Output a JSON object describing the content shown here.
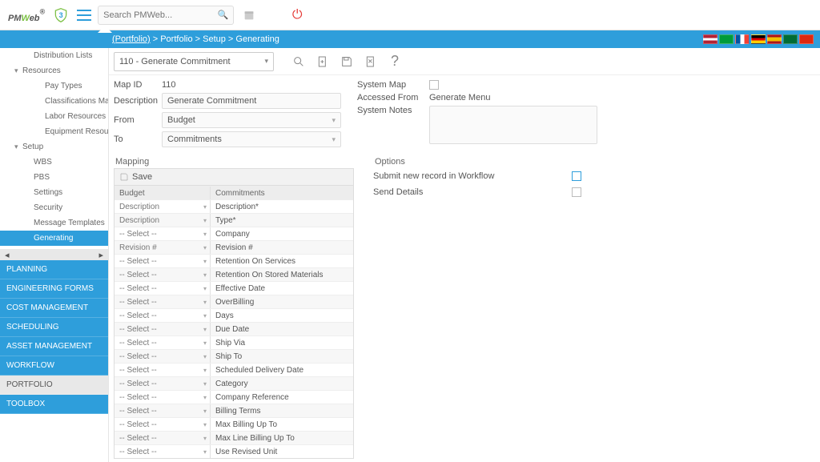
{
  "header": {
    "logo_text_prefix": "PM",
    "logo_text_accent": "W",
    "logo_text_suffix": "eb",
    "shield_badge": "3",
    "search_placeholder": "Search PMWeb..."
  },
  "breadcrumb": {
    "portfolio_link": "(Portfolio)",
    "trail": " > Portfolio > Setup > Generating"
  },
  "flags": [
    "us",
    "br",
    "fr",
    "de",
    "es",
    "sa",
    "cn"
  ],
  "sidebar": {
    "tree": [
      {
        "label": "Distribution Lists",
        "level": "l2"
      },
      {
        "label": "Resources",
        "level": "l1",
        "caret": true,
        "open": true
      },
      {
        "label": "Pay Types",
        "level": "l3"
      },
      {
        "label": "Classifications Ma",
        "level": "l3"
      },
      {
        "label": "Labor Resources",
        "level": "l3"
      },
      {
        "label": "Equipment Resour",
        "level": "l3"
      },
      {
        "label": "Setup",
        "level": "l1",
        "caret": true,
        "open": true
      },
      {
        "label": "WBS",
        "level": "l2"
      },
      {
        "label": "PBS",
        "level": "l2"
      },
      {
        "label": "Settings",
        "level": "l2"
      },
      {
        "label": "Security",
        "level": "l2"
      },
      {
        "label": "Message Templates",
        "level": "l2"
      },
      {
        "label": "Generating",
        "level": "l2",
        "sel": true
      }
    ],
    "modules": [
      "PLANNING",
      "ENGINEERING FORMS",
      "COST MANAGEMENT",
      "SCHEDULING",
      "ASSET MANAGEMENT",
      "WORKFLOW",
      "PORTFOLIO",
      "TOOLBOX"
    ],
    "active_module": "PORTFOLIO"
  },
  "toolbar": {
    "record_selector": "110 - Generate Commitment"
  },
  "form": {
    "map_id_label": "Map ID",
    "map_id": "110",
    "description_label": "Description",
    "description": "Generate Commitment",
    "from_label": "From",
    "from": "Budget",
    "to_label": "To",
    "to": "Commitments",
    "system_map_label": "System Map",
    "accessed_from_label": "Accessed From",
    "accessed_from": "Generate Menu",
    "system_notes_label": "System Notes"
  },
  "mapping": {
    "title": "Mapping",
    "save_label": "Save",
    "col_left": "Budget",
    "col_right": "Commitments",
    "rows": [
      {
        "l": "Description",
        "r": "Description*"
      },
      {
        "l": "Description",
        "r": "Type*"
      },
      {
        "l": "-- Select --",
        "r": "Company"
      },
      {
        "l": "Revision #",
        "r": "Revision #"
      },
      {
        "l": "-- Select --",
        "r": "Retention On Services"
      },
      {
        "l": "-- Select --",
        "r": "Retention On Stored Materials"
      },
      {
        "l": "-- Select --",
        "r": "Effective Date"
      },
      {
        "l": "-- Select --",
        "r": "OverBilling"
      },
      {
        "l": "-- Select --",
        "r": "Days"
      },
      {
        "l": "-- Select --",
        "r": "Due Date"
      },
      {
        "l": "-- Select --",
        "r": "Ship Via"
      },
      {
        "l": "-- Select --",
        "r": "Ship To"
      },
      {
        "l": "-- Select --",
        "r": "Scheduled Delivery Date"
      },
      {
        "l": "-- Select --",
        "r": "Category"
      },
      {
        "l": "-- Select --",
        "r": "Company Reference"
      },
      {
        "l": "-- Select --",
        "r": "Billing Terms"
      },
      {
        "l": "-- Select --",
        "r": "Max Billing Up To"
      },
      {
        "l": "-- Select --",
        "r": "Max Line Billing Up To"
      },
      {
        "l": "-- Select --",
        "r": "Use Revised Unit"
      }
    ]
  },
  "options": {
    "title": "Options",
    "submit_label": "Submit new record in Workflow",
    "send_details_label": "Send Details"
  }
}
